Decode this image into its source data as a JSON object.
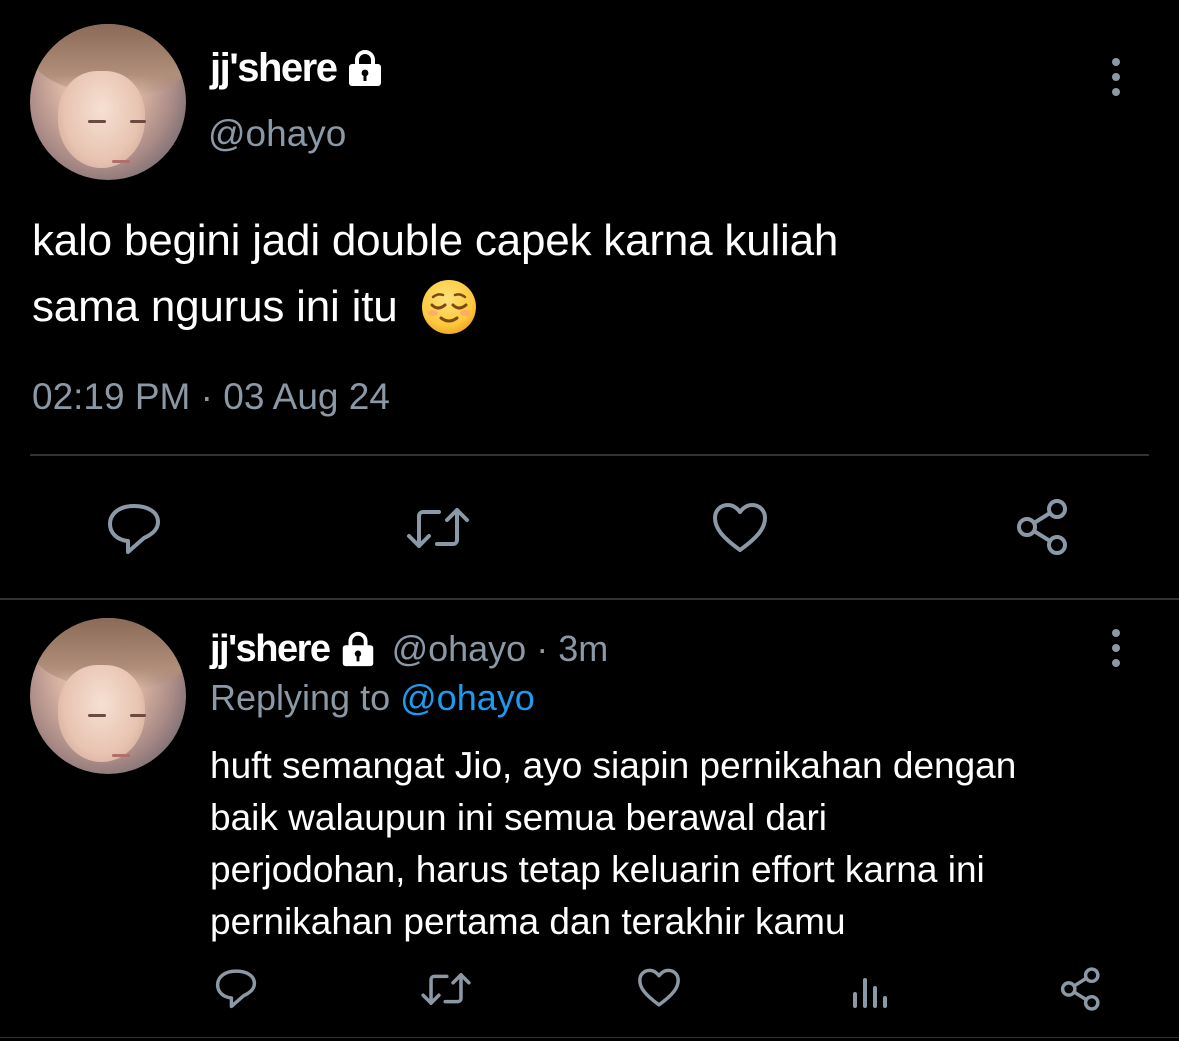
{
  "colors": {
    "background": "#000000",
    "text_primary": "#ffffff",
    "text_muted": "#8b98a5",
    "link": "#1d9bf0",
    "divider": "#2f3336"
  },
  "main_tweet": {
    "display_name": "jj'shere",
    "handle": "@ohayo",
    "text_line1": "kalo begini jadi double capek karna kuliah",
    "text_line2": "sama ngurus ini itu",
    "emoji": "😌",
    "timestamp": "02:19 PM · 03 Aug 24",
    "icons": {
      "avatar": "avatar-image",
      "lock": "lock-icon",
      "more": "more-vertical-icon"
    },
    "actions": [
      "reply-icon",
      "retweet-icon",
      "like-icon",
      "share-icon"
    ]
  },
  "reply_tweet": {
    "display_name": "jj'shere",
    "handle": "@ohayo",
    "separator": "·",
    "time": "3m",
    "replying_to_label": "Replying to",
    "replying_to_handle": "@ohayo",
    "text_lines": [
      "huft semangat Jio, ayo siapin pernikahan dengan",
      "baik walaupun ini semua berawal dari",
      "perjodohan, harus tetap keluarin effort karna ini",
      "pernikahan pertama dan terakhir kamu"
    ],
    "actions": [
      "reply-icon",
      "retweet-icon",
      "like-icon",
      "analytics-icon",
      "share-icon"
    ]
  }
}
